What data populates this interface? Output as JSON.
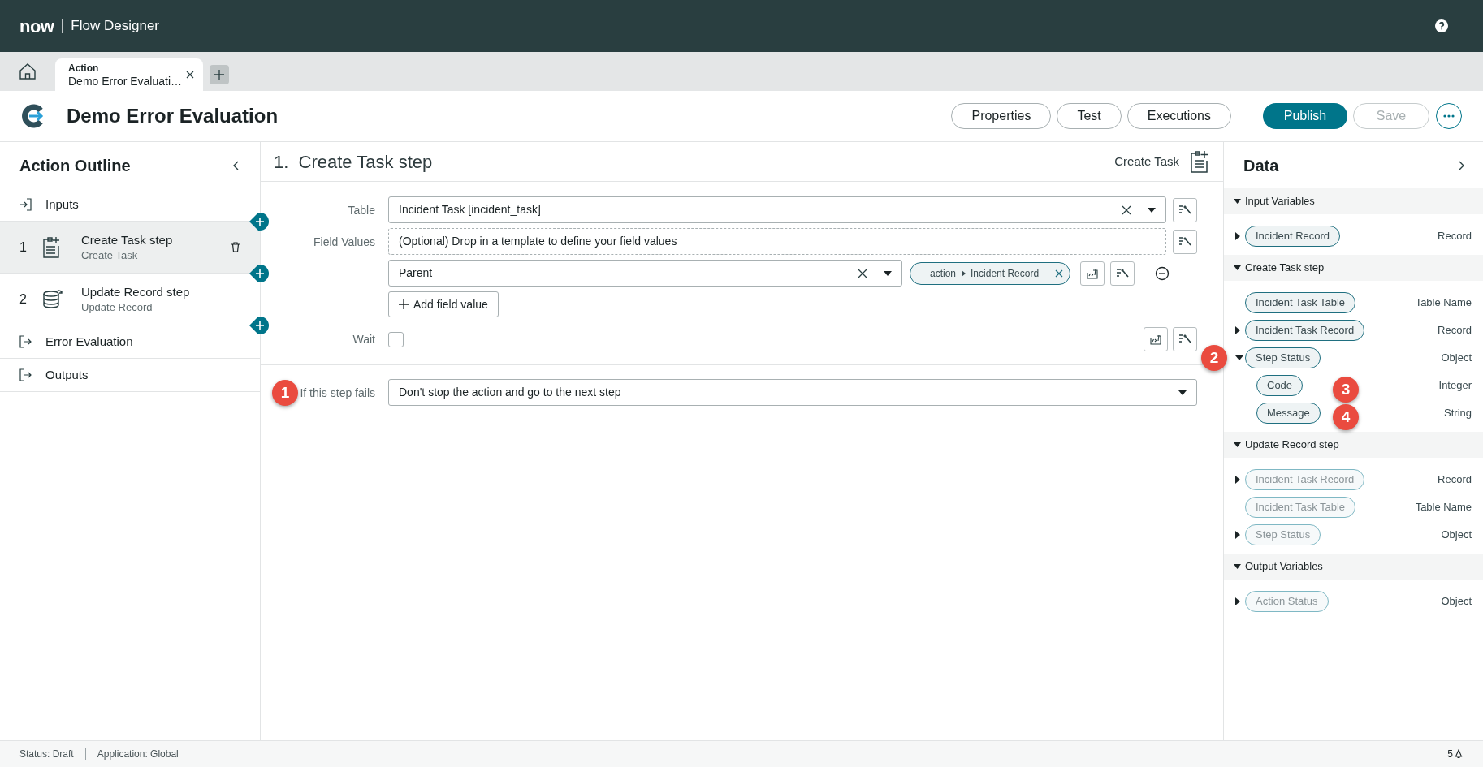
{
  "app": {
    "logo": "now",
    "title": "Flow Designer"
  },
  "tabs": [
    {
      "type": "Action",
      "label": "Demo Error Evaluati…",
      "selected": true
    }
  ],
  "toolbar": {
    "title": "Demo Error Evaluation",
    "buttons": [
      {
        "label": "Properties",
        "kind": "outline",
        "disabled": false
      },
      {
        "label": "Test",
        "kind": "outline",
        "disabled": false
      },
      {
        "label": "Executions",
        "kind": "outline",
        "disabled": false
      },
      {
        "label": "Publish",
        "kind": "primary",
        "disabled": false
      },
      {
        "label": "Save",
        "kind": "outline",
        "disabled": true
      }
    ]
  },
  "outline": {
    "title": "Action Outline",
    "items": [
      {
        "kind": "inputs",
        "label": "Inputs"
      },
      {
        "kind": "create_step",
        "number": "1",
        "label": "Create Task step",
        "sublabel": "Create Task",
        "selected": true
      },
      {
        "kind": "update_step",
        "number": "2",
        "label": "Update Record step",
        "sublabel": "Update Record",
        "selected": false
      },
      {
        "kind": "section",
        "label": "Error Evaluation"
      },
      {
        "kind": "section",
        "label": "Outputs"
      }
    ]
  },
  "step": {
    "number": "1.",
    "heading": "Create Task step",
    "action_type": "Create Task",
    "table": {
      "label": "Table",
      "value": "Incident Task [incident_task]"
    },
    "field_values": {
      "label": "Field Values",
      "placeholder": "(Optional) Drop in a template to define your field values",
      "rows": [
        {
          "field": "Parent",
          "pill_scope": "action",
          "pill_value": "Incident Record"
        }
      ],
      "add_button": "Add field value"
    },
    "wait": {
      "label": "Wait",
      "checked": false
    },
    "on_failure": {
      "label": "If this step fails",
      "value": "Don't stop the action and go to the next step",
      "callout": "1"
    }
  },
  "data_panel": {
    "title": "Data",
    "sections": [
      {
        "title": "Input Variables",
        "items": [
          {
            "label": "Incident Record",
            "type": "Record",
            "expandable": true,
            "expanded": false,
            "dimmed": false
          }
        ]
      },
      {
        "title": "Create Task step",
        "items": [
          {
            "label": "Incident Task Table",
            "type": "Table Name",
            "expandable": false,
            "dimmed": false
          },
          {
            "label": "Incident Task Record",
            "type": "Record",
            "expandable": true,
            "expanded": false,
            "dimmed": false
          },
          {
            "label": "Step Status",
            "type": "Object",
            "expandable": true,
            "expanded": true,
            "dimmed": false,
            "callout": "2",
            "children": [
              {
                "label": "Code",
                "type": "Integer",
                "dimmed": false,
                "callout": "3"
              },
              {
                "label": "Message",
                "type": "String",
                "dimmed": false,
                "callout": "4"
              }
            ]
          }
        ]
      },
      {
        "title": "Update Record step",
        "items": [
          {
            "label": "Incident Task Record",
            "type": "Record",
            "expandable": true,
            "expanded": false,
            "dimmed": true
          },
          {
            "label": "Incident Task Table",
            "type": "Table Name",
            "expandable": false,
            "dimmed": true
          },
          {
            "label": "Step Status",
            "type": "Object",
            "expandable": true,
            "expanded": false,
            "dimmed": true
          }
        ]
      },
      {
        "title": "Output Variables",
        "items": [
          {
            "label": "Action Status",
            "type": "Object",
            "expandable": true,
            "expanded": false,
            "dimmed": true
          }
        ]
      }
    ]
  },
  "status_bar": {
    "status": "Status: Draft",
    "application": "Application: Global",
    "notifications": "5"
  }
}
